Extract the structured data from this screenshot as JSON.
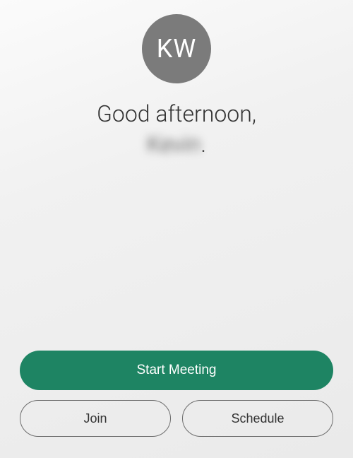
{
  "avatar": {
    "initials": "KW"
  },
  "greeting": {
    "prefix": "Good afternoon,",
    "name": "Kevin",
    "suffix": "."
  },
  "buttons": {
    "start_label": "Start Meeting",
    "join_label": "Join",
    "schedule_label": "Schedule"
  },
  "colors": {
    "primary": "#1e8463"
  }
}
